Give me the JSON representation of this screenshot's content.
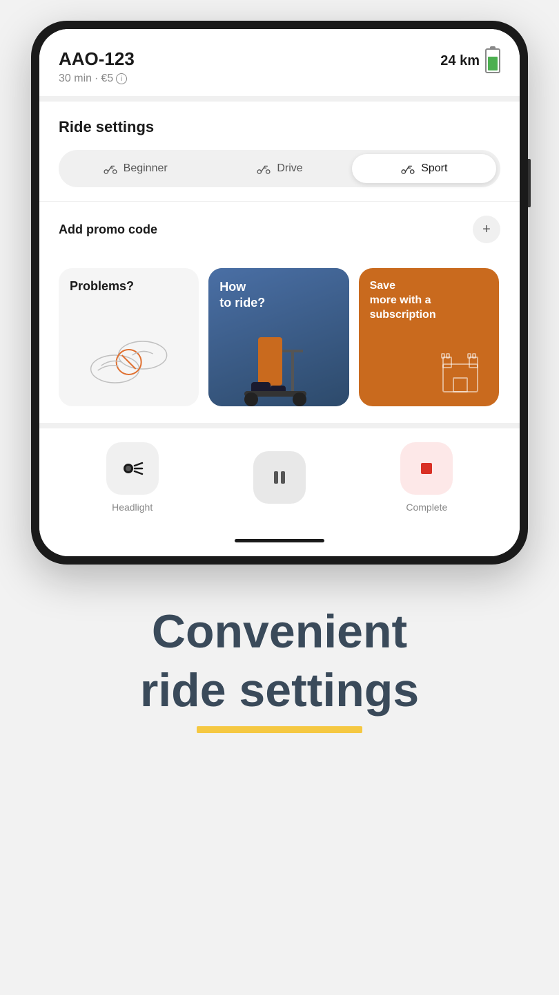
{
  "vehicle": {
    "id": "AAO-123",
    "duration": "30 min",
    "price": "€5",
    "distance": "24 km"
  },
  "ride_settings": {
    "title": "Ride settings",
    "modes": [
      {
        "id": "beginner",
        "label": "Beginner",
        "active": false
      },
      {
        "id": "drive",
        "label": "Drive",
        "active": false
      },
      {
        "id": "sport",
        "label": "Sport",
        "active": true
      }
    ]
  },
  "promo": {
    "title": "Add promo code",
    "plus_label": "+"
  },
  "cards": [
    {
      "id": "problems",
      "title": "Problems?"
    },
    {
      "id": "how",
      "title": "How\nto ride?"
    },
    {
      "id": "save",
      "title": "Save\nmore with a\nsubscription"
    }
  ],
  "actions": [
    {
      "id": "headlight",
      "label": "Headlight"
    },
    {
      "id": "pause",
      "label": ""
    },
    {
      "id": "complete",
      "label": "Complete"
    }
  ],
  "bottom": {
    "line1": "Convenient",
    "line2": "ride settings"
  }
}
